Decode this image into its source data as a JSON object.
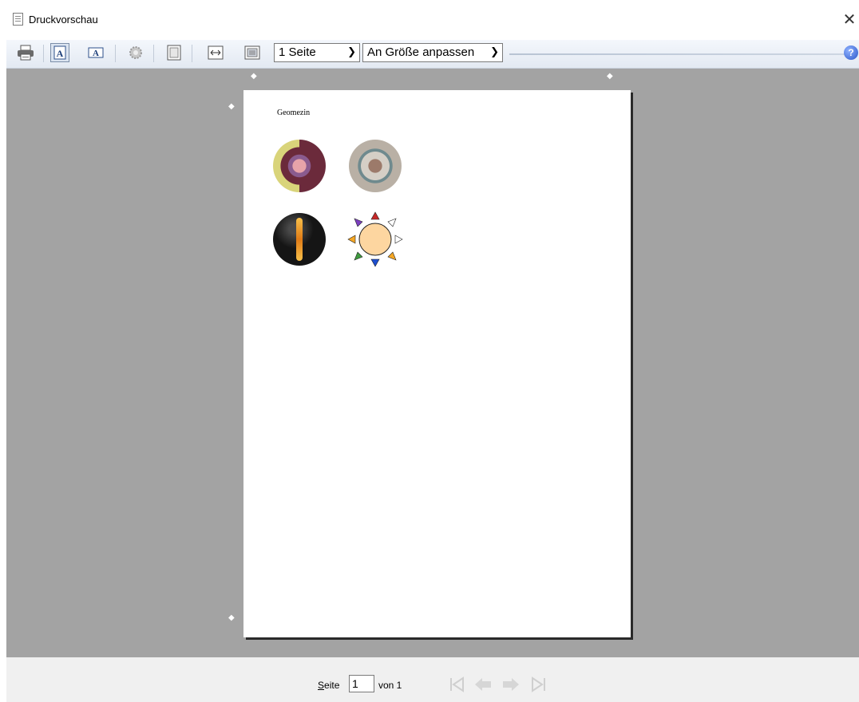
{
  "window": {
    "title": "Druckvorschau",
    "close_glyph": "✕"
  },
  "toolbar": {
    "buttons": [
      {
        "name": "print-icon"
      },
      {
        "name": "portrait-icon",
        "active": true
      },
      {
        "name": "landscape-icon"
      },
      {
        "name": "page-setup-icon"
      },
      {
        "name": "full-page-icon"
      },
      {
        "name": "fit-width-icon"
      },
      {
        "name": "shrink-to-fit-icon"
      }
    ],
    "pages_select": "1 Seite",
    "zoom_select": "An Größe anpassen",
    "help_label": "?"
  },
  "page": {
    "title": "Geomezin",
    "images": [
      {
        "name": "geomezin-image-1",
        "colors": [
          "#6b2a3b",
          "#d9d47a",
          "#c65a2e"
        ]
      },
      {
        "name": "geomezin-image-2",
        "colors": [
          "#b9b0a5",
          "#6f8a8e",
          "#d5cfc6"
        ]
      },
      {
        "name": "geomezin-image-3",
        "colors": [
          "#151515",
          "#f0a020",
          "#3a3a3a"
        ]
      },
      {
        "name": "sun-directions-icon",
        "colors": [
          "#fdd6a0",
          "#c62828",
          "#1e4fd0",
          "#7b3fbf",
          "#3e9a3e",
          "#f5a623"
        ]
      }
    ]
  },
  "statusbar": {
    "page_label_mnemonic": "S",
    "page_label_rest": "eite",
    "page_value": "1",
    "of_label": "von 1"
  },
  "colors": {
    "preview_background": "#a3a3a3",
    "toolbar_accent": "#e3e9f2"
  }
}
